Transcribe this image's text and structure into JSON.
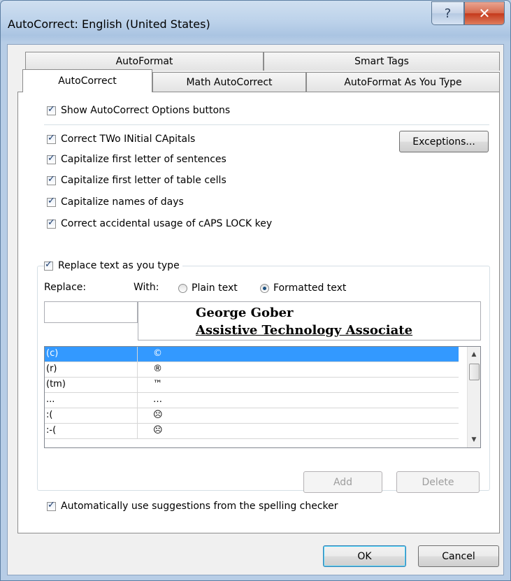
{
  "window": {
    "title": "AutoCorrect: English (United States)",
    "help_glyph": "?",
    "close_glyph": "✕"
  },
  "tabs": {
    "row1": [
      {
        "label": "AutoFormat"
      },
      {
        "label": "Smart Tags"
      }
    ],
    "row2": [
      {
        "label": "AutoCorrect",
        "active": true
      },
      {
        "label": "Math AutoCorrect"
      },
      {
        "label": "AutoFormat As You Type"
      }
    ]
  },
  "options": {
    "show_buttons": "Show AutoCorrect Options buttons",
    "two_initial": "Correct TWo INitial CApitals",
    "sentences": "Capitalize first letter of sentences",
    "table_cells": "Capitalize first letter of table cells",
    "days": "Capitalize names of days",
    "caps_lock": "Correct accidental usage of cAPS LOCK key",
    "exceptions_button": "Exceptions..."
  },
  "replace_group": {
    "checkbox_label": "Replace text as you type",
    "replace_label": "Replace:",
    "with_label": "With:",
    "plain_text": "Plain text",
    "formatted_text": "Formatted text",
    "replace_value": "",
    "with_line1": "George Gober",
    "with_line2": "Assistive Technology Associate",
    "entries": [
      {
        "replace": "(c)",
        "with": "©",
        "selected": true
      },
      {
        "replace": "(r)",
        "with": "®"
      },
      {
        "replace": "(tm)",
        "with": "™"
      },
      {
        "replace": "...",
        "with": "…"
      },
      {
        "replace": ":(",
        "with": "☹"
      },
      {
        "replace": ":-(",
        "with": "☹"
      }
    ],
    "add_button": "Add",
    "delete_button": "Delete",
    "suggestions": "Automatically use suggestions from the spelling checker"
  },
  "footer": {
    "ok": "OK",
    "cancel": "Cancel"
  }
}
